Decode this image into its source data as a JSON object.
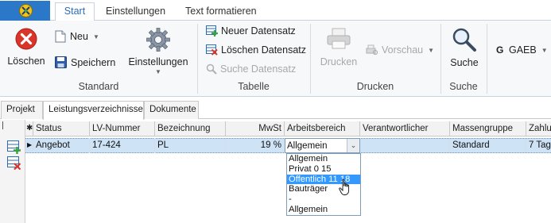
{
  "ribbon_tabs": {
    "start": "Start",
    "einstellungen": "Einstellungen",
    "text_formatieren": "Text formatieren"
  },
  "groups": {
    "standard": {
      "label": "Standard",
      "loeschen": "Löschen",
      "neu": "Neu",
      "speichern": "Speichern",
      "einstellungen": "Einstellungen"
    },
    "tabelle": {
      "label": "Tabelle",
      "neuer_datensatz": "Neuer Datensatz",
      "loeschen_datensatz": "Löschen Datensatz",
      "suche_datensatz": "Suche Datensatz"
    },
    "drucken": {
      "label": "Drucken",
      "drucken": "Drucken",
      "vorschau": "Vorschau"
    },
    "suche": {
      "label": "Suche",
      "suche": "Suche"
    },
    "gaeb": {
      "label": "GAEB"
    }
  },
  "doc_tabs": [
    "Projekt",
    "Leistungsverzeichnisse",
    "Dokumente"
  ],
  "grid": {
    "headers": [
      "Status",
      "LV-Nummer",
      "Bezeichnung",
      "MwSt",
      "Arbeitsbereich",
      "Verantwortlicher",
      "Massengruppe",
      "Zahlu"
    ],
    "row": {
      "status": "Angebot",
      "lv_nummer": "17-424",
      "bezeichnung": "PL",
      "mwst": "19 %",
      "arbeitsbereich": "Allgemein",
      "verantwortlicher": "",
      "massengruppe": "Standard",
      "zahlung": "7 Tag"
    }
  },
  "dropdown_options": [
    "Allgemein",
    "Privat 0 15",
    "Öffentlich 11 18",
    "Bauträger",
    "-",
    "Allgemein"
  ],
  "dropdown_selected": "Öffentlich 11 18",
  "colors": {
    "accent": "#2b77c8",
    "selection": "#3399ff",
    "row_selected": "#cfe3f7",
    "delete_red": "#d9362b"
  }
}
